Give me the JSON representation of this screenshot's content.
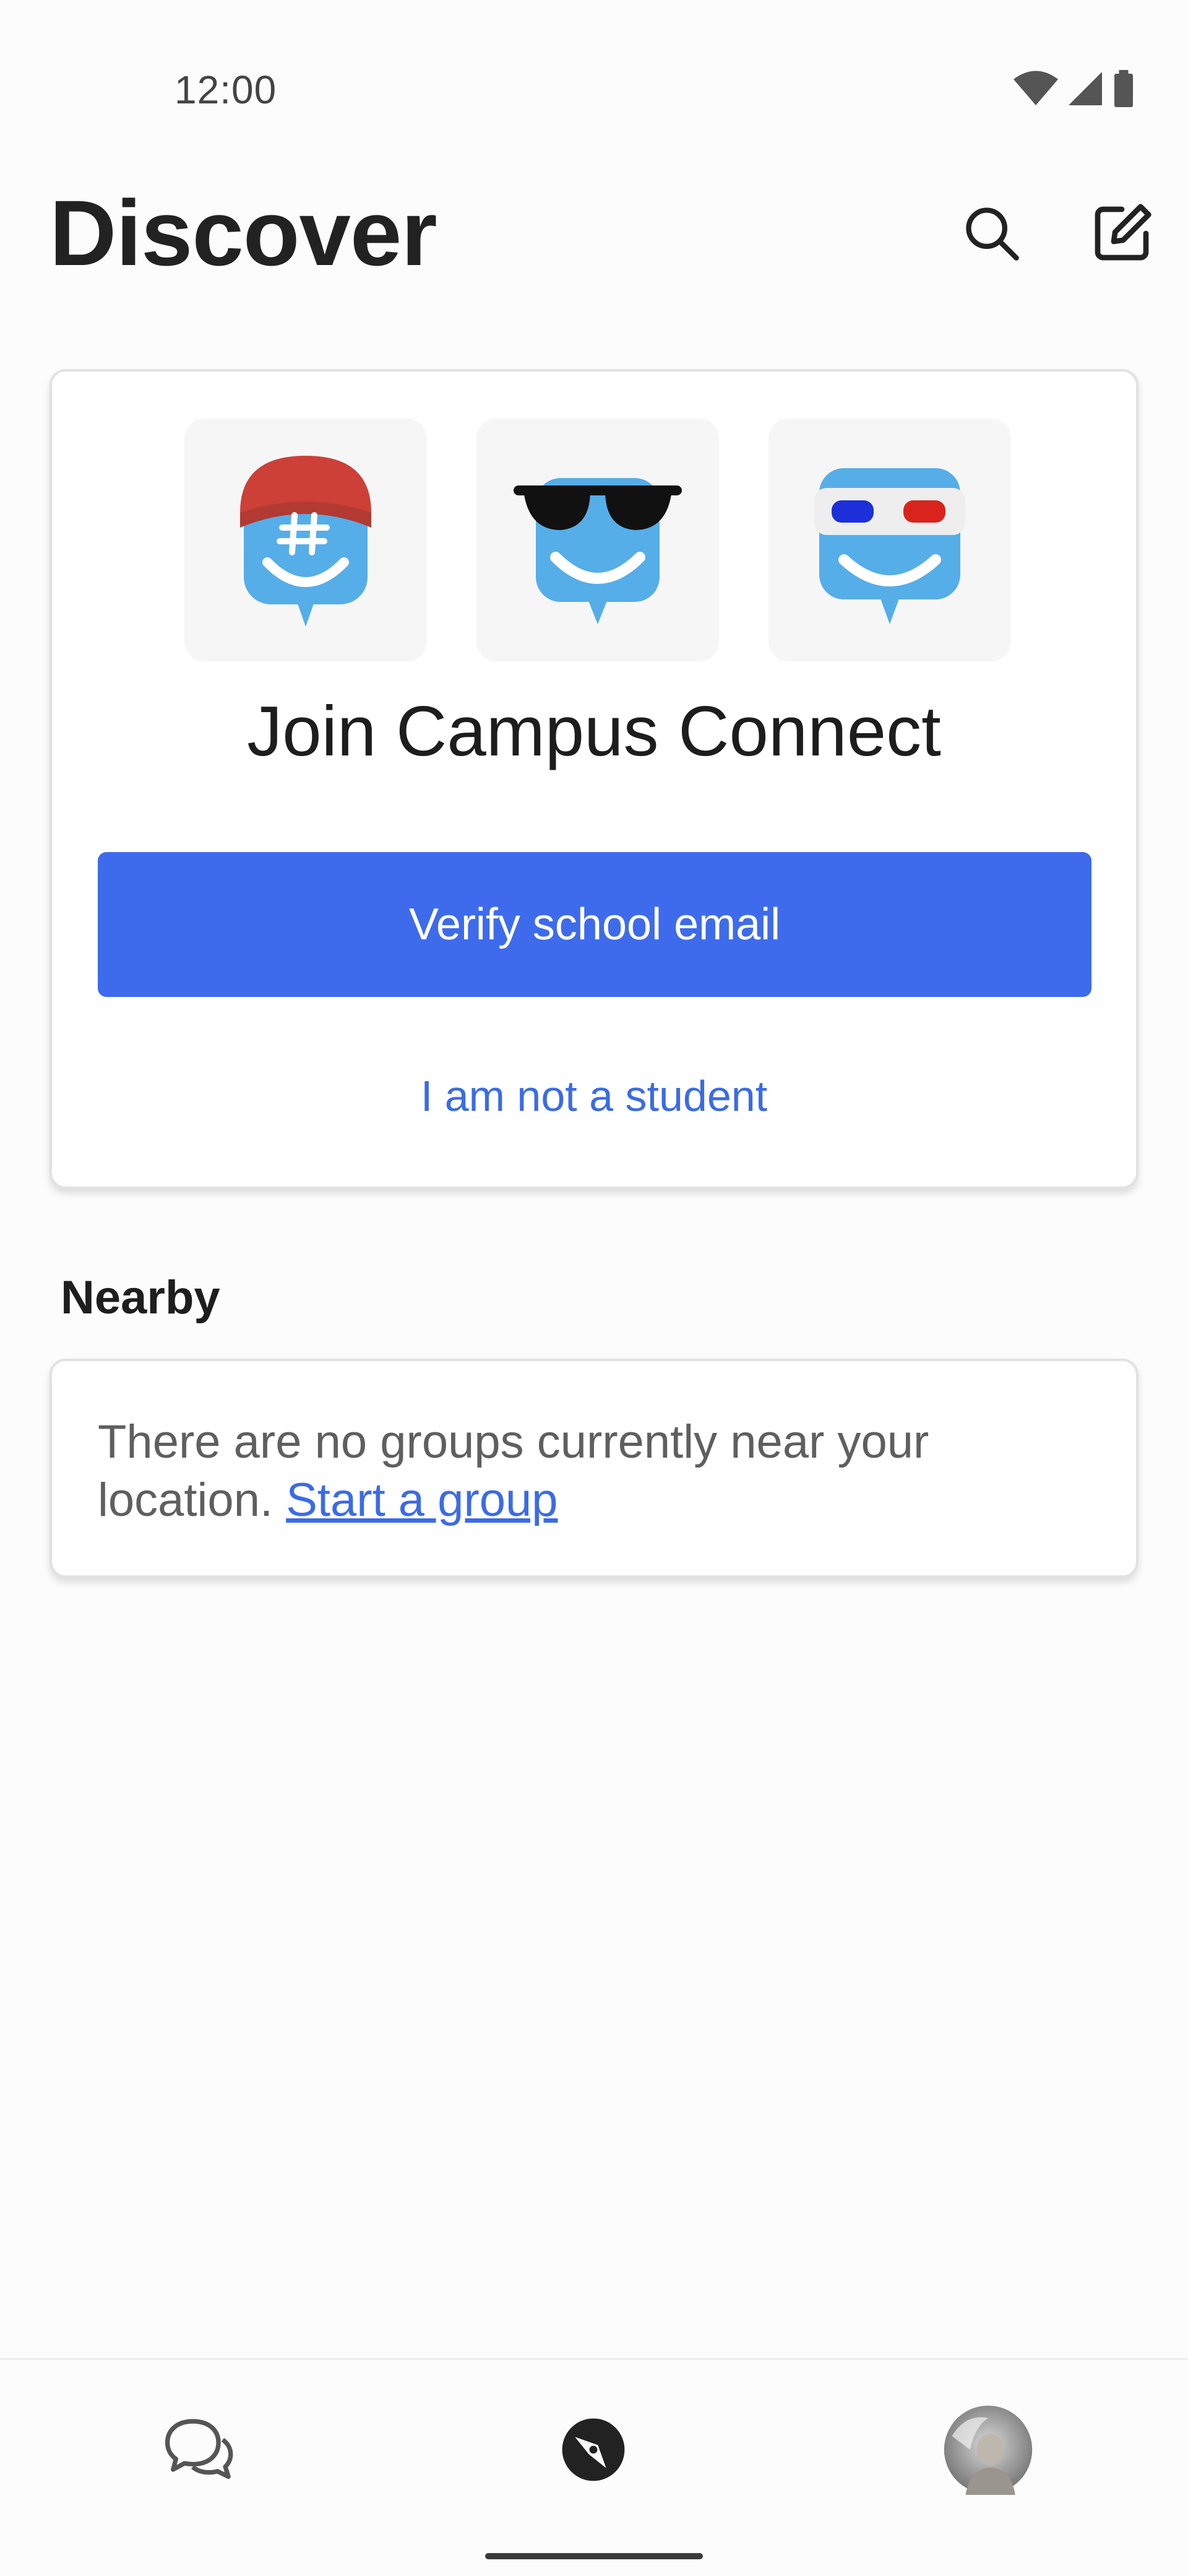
{
  "status_bar": {
    "time": "12:00",
    "icons": [
      "wifi-icon",
      "cellular-signal-icon",
      "battery-icon"
    ]
  },
  "header": {
    "title": "Discover",
    "actions": [
      "search-icon",
      "compose-icon"
    ]
  },
  "join_card": {
    "avatars": [
      "red-cap-mascot",
      "sunglasses-mascot",
      "3d-glasses-mascot"
    ],
    "title": "Join Campus Connect",
    "verify_button": "Verify school email",
    "not_student_link": "I am not a student"
  },
  "nearby": {
    "title": "Nearby",
    "empty_message": "There are no groups currently near your location. ",
    "start_group_link": "Start a group"
  },
  "bottom_nav": {
    "items": [
      "chats-icon",
      "discover-compass-icon",
      "profile-avatar"
    ],
    "active": "discover-compass-icon"
  },
  "colors": {
    "accent": "#3e6bec",
    "link": "#3b6be6",
    "mascot_blue": "#55aee8",
    "cap_red": "#cc4038"
  }
}
